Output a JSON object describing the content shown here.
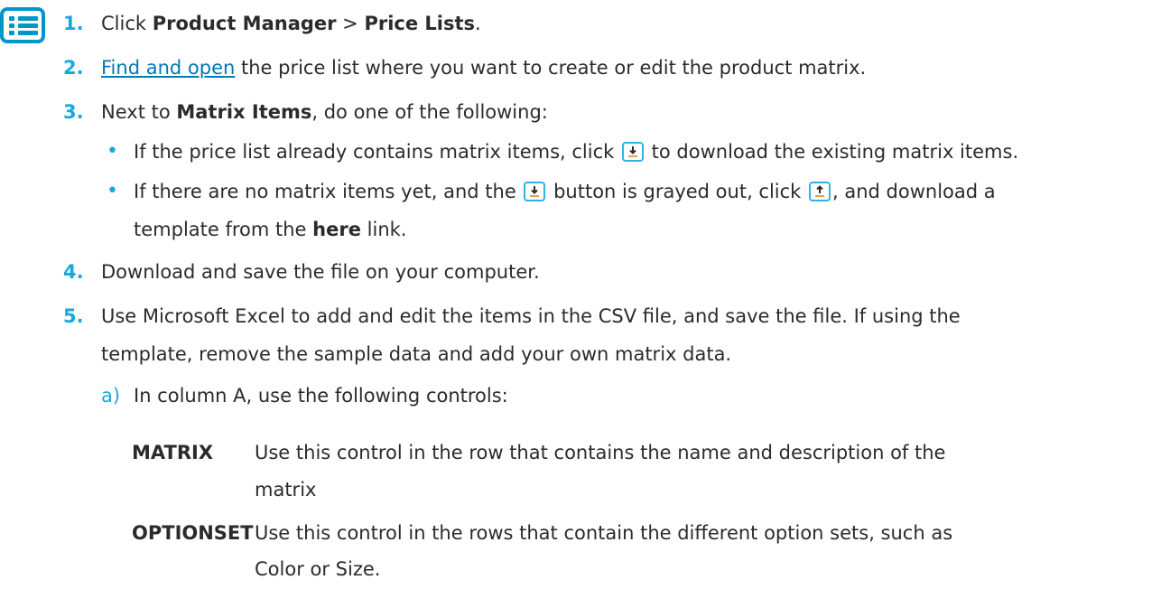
{
  "steps": {
    "s1": {
      "num": "1.",
      "pre": "Click ",
      "b1": "Product Manager",
      "mid": " > ",
      "b2": "Price Lists",
      "post": "."
    },
    "s2": {
      "num": "2.",
      "link": "Find and open",
      "post": " the price list where you want to create or edit the product matrix."
    },
    "s3": {
      "num": "3.",
      "pre": "Next to ",
      "b": "Matrix Items",
      "post": ", do one of the following:",
      "bullet1": {
        "pre": "If the price list already contains matrix items, click ",
        "post": " to download the existing matrix items."
      },
      "bullet2": {
        "pre": "If there are no matrix items yet, and the ",
        "mid": " button is grayed out, click ",
        "post": ", and download a",
        "line2_pre": "template from the ",
        "line2_b": "here",
        "line2_post": " link."
      }
    },
    "s4": {
      "num": "4.",
      "text": "Download and save the file on your computer."
    },
    "s5": {
      "num": "5.",
      "line1": "Use Microsoft Excel to add and edit the items in the CSV file, and save the file. If using the",
      "line2": "template, remove the sample data and add your own matrix data.",
      "suba": {
        "label": "a)",
        "text": "In column A, use the following controls:"
      },
      "controls": [
        {
          "term": "MATRIX",
          "def1": "Use this control in the row that contains the name and description of the",
          "def2": "matrix"
        },
        {
          "term": "OPTIONSET",
          "def1": "Use this control in the rows that contain the different option sets, such as",
          "def2": "Color or Size."
        }
      ]
    }
  },
  "icons": {
    "list": "list-steps-icon",
    "download": "download-icon",
    "upload": "upload-icon"
  },
  "colors": {
    "accent": "#17a9dd",
    "link": "#0079b5",
    "text": "#2b2b2b"
  }
}
